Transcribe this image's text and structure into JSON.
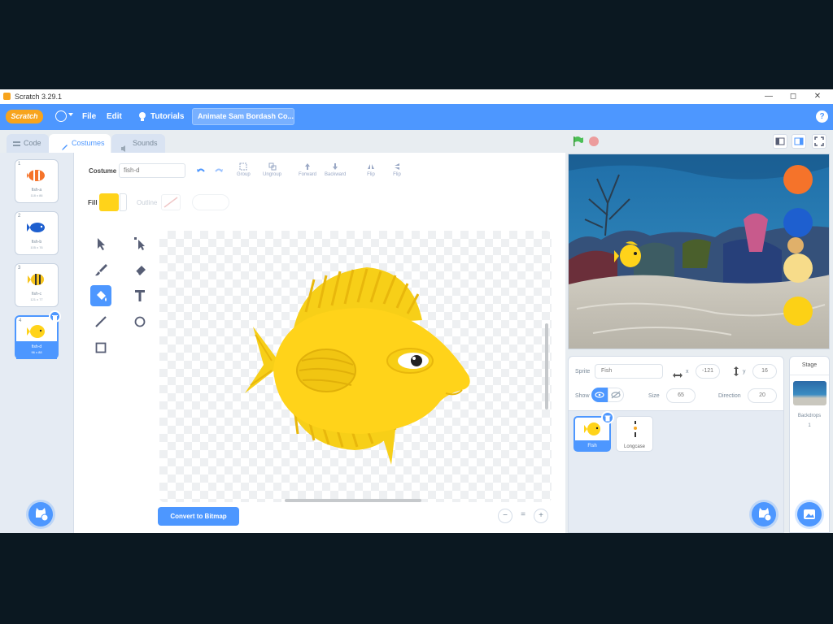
{
  "window": {
    "title": "Scratch 3.29.1",
    "minimize": "—",
    "maximize": "◻",
    "close": "✕"
  },
  "menubar": {
    "logo": "Scratch",
    "file": "File",
    "edit": "Edit",
    "tutorials": "Tutorials",
    "project_title": "Animate Sam Bordash Co..."
  },
  "tabs": {
    "code": "Code",
    "costumes": "Costumes",
    "sounds": "Sounds"
  },
  "costumes": [
    {
      "num": "1",
      "name": "fish-a",
      "size": "118 x 86"
    },
    {
      "num": "2",
      "name": "fish-b",
      "size": "105 x 76"
    },
    {
      "num": "3",
      "name": "fish-c",
      "size": "121 x 77"
    },
    {
      "num": "4",
      "name": "fish-d",
      "size": "96 x 88"
    }
  ],
  "toolbar": {
    "costume_label": "Costume",
    "costume_name": "fish-d",
    "group": "Group",
    "ungroup": "Ungroup",
    "forward": "Forward",
    "backward": "Backward",
    "flip_h": "Flip",
    "flip_v": "Flip",
    "fill_label": "Fill",
    "outline_label": "Outline"
  },
  "convert_button": "Convert to Bitmap",
  "zoom": {
    "out": "−",
    "reset": "=",
    "in": "+"
  },
  "sprite_info": {
    "sprite_label": "Sprite",
    "sprite_name": "Fish",
    "x_label": "x",
    "x_value": "-121",
    "y_label": "y",
    "y_value": "16",
    "show_label": "Show",
    "size_label": "Size",
    "size_value": "65",
    "direction_label": "Direction",
    "direction_value": "20"
  },
  "sprites": [
    {
      "name": "Fish"
    },
    {
      "name": "Longcase"
    }
  ],
  "stage_panel": {
    "title": "Stage",
    "backdrops_label": "Backdrops",
    "backdrops_count": "1"
  },
  "colors": {
    "accent": "#4d97ff",
    "fish": "#ffd31a",
    "fish_dark": "#e8b70c",
    "orange_ball": "#f5732a",
    "blue_ball": "#1e5fcf",
    "cream_ball": "#f7dc8a",
    "yellow_ball": "#fcd116"
  }
}
